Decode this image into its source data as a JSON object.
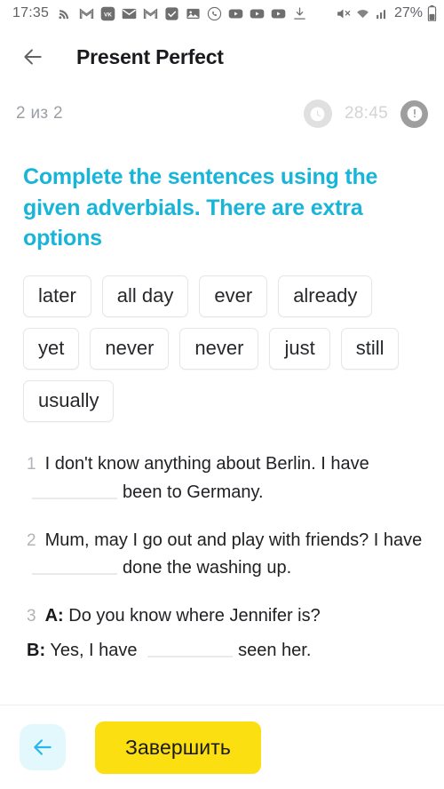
{
  "statusbar": {
    "time": "17:35",
    "battery_text": "27%",
    "icons": [
      {
        "name": "rss-icon"
      },
      {
        "name": "gmail-outline-icon"
      },
      {
        "name": "vk-icon"
      },
      {
        "name": "mail-icon"
      },
      {
        "name": "gmail-icon"
      },
      {
        "name": "checkbox-icon"
      },
      {
        "name": "photo-icon"
      },
      {
        "name": "viber-icon"
      },
      {
        "name": "youtube-icon"
      },
      {
        "name": "youtube-icon-2"
      },
      {
        "name": "youtube-icon-3"
      },
      {
        "name": "download-icon"
      }
    ],
    "right_icons": [
      {
        "name": "mute-icon"
      },
      {
        "name": "wifi-icon"
      },
      {
        "name": "signal-icon"
      },
      {
        "name": "battery-icon"
      }
    ]
  },
  "header": {
    "back_label": "back-arrow",
    "title": "Present Perfect"
  },
  "progress": {
    "counter": "2 из 2",
    "timer": "28:45",
    "clock_icon": "clock-icon",
    "warning_icon": "exclamation-icon"
  },
  "exercise": {
    "instruction": "Complete the sentences using the given adverbials. There are extra options",
    "options": [
      "later",
      "all day",
      "ever",
      "already",
      "yet",
      "never",
      "never",
      "just",
      "still",
      "usually"
    ],
    "questions": [
      {
        "number": "1",
        "part1": "I don't know anything about Berlin. I have",
        "part2": "been to Germany."
      },
      {
        "number": "2",
        "part1": "Mum, may I go out and play with friends? I",
        "part2": "have",
        "part3": "done the washing up."
      },
      {
        "number": "3",
        "speaker_a": "A:",
        "line_a": "Do you know where Jennifer is?",
        "speaker_b": "B:",
        "line_b1": "Yes, I have",
        "line_b2": "seen her."
      }
    ]
  },
  "bottom": {
    "prev_icon": "arrow-left-icon",
    "finish_label": "Завершить"
  },
  "colors": {
    "accent_cyan": "#18b5d8",
    "finish_yellow": "#fbdf10",
    "prev_bg": "#e3f8fd",
    "muted_gray": "#9aa0a6"
  }
}
